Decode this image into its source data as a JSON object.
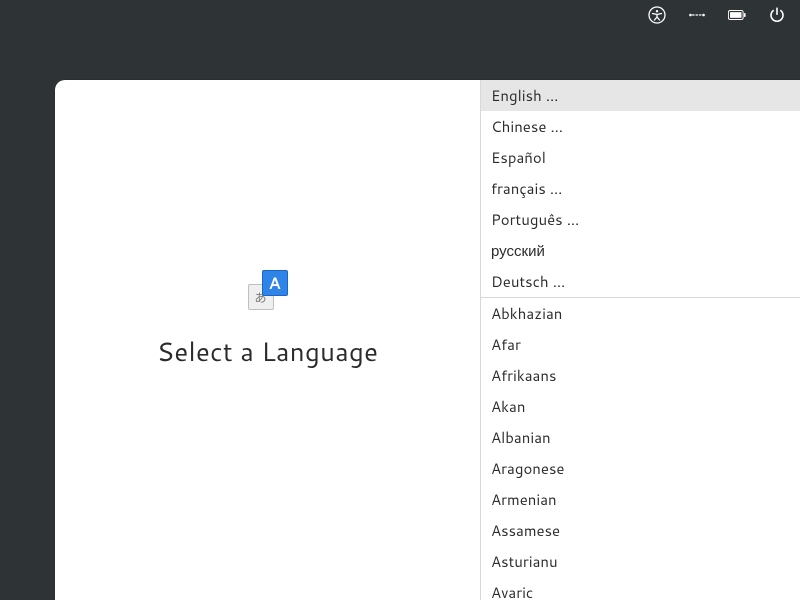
{
  "topbar": {
    "accessibility_icon": "accessibility",
    "network_icon": "network-wired",
    "battery_icon": "battery",
    "power_icon": "power"
  },
  "panel": {
    "title": "Select a Language",
    "icon_glyph_front": "A",
    "icon_glyph_back": "あ"
  },
  "languages_top": [
    {
      "label": "English …",
      "selected": true
    },
    {
      "label": "Chinese …",
      "selected": false
    },
    {
      "label": "Español",
      "selected": false
    },
    {
      "label": "français …",
      "selected": false
    },
    {
      "label": "Português …",
      "selected": false
    },
    {
      "label": "русский",
      "selected": false
    },
    {
      "label": "Deutsch …",
      "selected": false
    }
  ],
  "languages_more": [
    {
      "label": "Abkhazian"
    },
    {
      "label": "Afar"
    },
    {
      "label": "Afrikaans"
    },
    {
      "label": "Akan"
    },
    {
      "label": "Albanian"
    },
    {
      "label": "Aragonese"
    },
    {
      "label": "Armenian"
    },
    {
      "label": "Assamese"
    },
    {
      "label": "Asturianu"
    },
    {
      "label": "Avaric"
    }
  ]
}
